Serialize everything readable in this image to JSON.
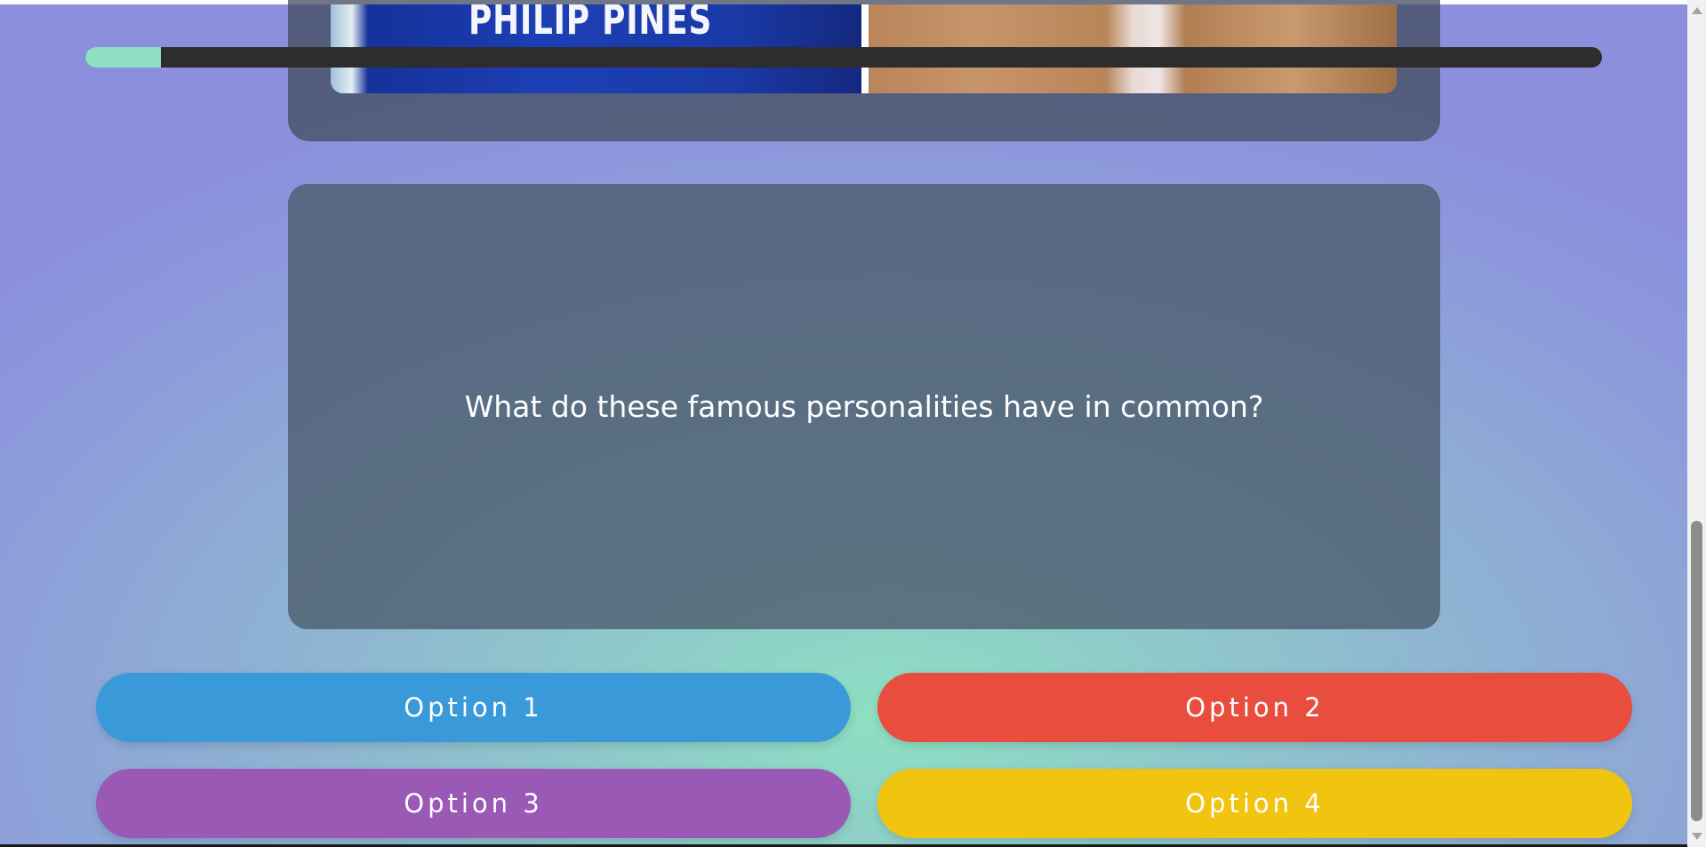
{
  "images": {
    "left_photo_text": "PHILIP PINES"
  },
  "progress": {
    "value_fraction": 0.05
  },
  "question": {
    "text": "What do these famous personalities have in common?"
  },
  "options": [
    {
      "label": "Option 1",
      "color": "#3a9ad9"
    },
    {
      "label": "Option 2",
      "color": "#e84d3d"
    },
    {
      "label": "Option 3",
      "color": "#9b59b6"
    },
    {
      "label": "Option 4",
      "color": "#f1c40f"
    }
  ],
  "theme": {
    "progress_fill": "#8fe0c3",
    "progress_track": "#2f2c2d"
  }
}
